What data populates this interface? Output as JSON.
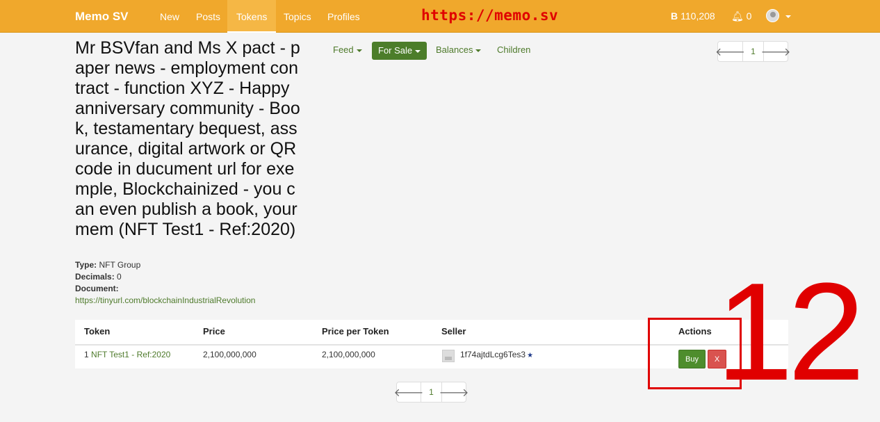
{
  "navbar": {
    "brand": "Memo SV",
    "items": [
      "New",
      "Posts",
      "Tokens",
      "Topics",
      "Profiles"
    ],
    "overlay_url": "https://memo.sv",
    "balance_symbol": "B",
    "balance": "110,208",
    "notifications": "0"
  },
  "token": {
    "title": "Mr BSVfan and Ms X pact - paper news - employment contract - function XYZ - Happy anniversary community - Book, testamentary bequest, assurance, digital artwork or QR code in ducument url for exemple, Blockchainized - you can even publish a book, your mem (NFT Test1 - Ref:2020)",
    "type_label": "Type:",
    "type_value": "NFT Group",
    "decimals_label": "Decimals:",
    "decimals_value": "0",
    "document_label": "Document:",
    "document_url": "https://tinyurl.com/blockchainIndustrialRevolution"
  },
  "subnav": {
    "feed": "Feed",
    "for_sale": "For Sale",
    "balances": "Balances",
    "children": "Children"
  },
  "pager_top": {
    "page": "1"
  },
  "pager_bottom": {
    "page": "1"
  },
  "table": {
    "headers": [
      "Token",
      "Price",
      "Price per Token",
      "Seller",
      "Actions"
    ],
    "rows": [
      {
        "qty": "1",
        "token_name": "NFT Test1 - Ref:2020",
        "price": "2,100,000,000",
        "price_per_token": "2,100,000,000",
        "seller": "1f74ajtdLcg6Tes3",
        "buy_label": "Buy",
        "cancel_label": "X"
      }
    ]
  },
  "annotation": {
    "number": "12"
  },
  "colors": {
    "navbar": "#f0a82c",
    "accent_green": "#4c7d2a",
    "annotation_red": "#e00000",
    "cancel_red": "#d9534f"
  }
}
